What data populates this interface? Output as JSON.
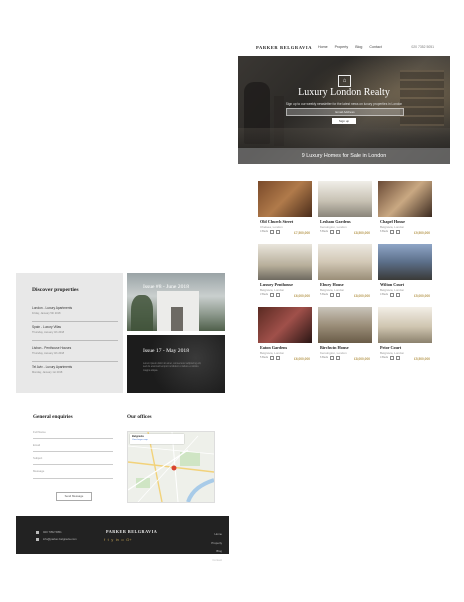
{
  "site": {
    "logo": "PARKER BELGRAVIA",
    "nav": [
      "Home",
      "Property",
      "Blog",
      "Contact"
    ],
    "phone": "020 7352 5051"
  },
  "hero": {
    "title": "Luxury London Realty",
    "subtitle": "Sign up to our weekly newsletter for the latest news on luxury properties in London",
    "input_placeholder": "Email Address",
    "button": "Sign up",
    "banner": "9 Luxury Homes for Sale in London"
  },
  "listings": [
    {
      "name": "Old Church Street",
      "location": "Chelsea, London",
      "beds": "4 Beds",
      "price": "£7,500,000"
    },
    {
      "name": "Lesham Gardens",
      "location": "Kensington, London",
      "beds": "5 Beds",
      "price": "£8,500,000"
    },
    {
      "name": "Chapel House",
      "location": "Belgravia, London",
      "beds": "6 Beds",
      "price": "£9,500,000"
    },
    {
      "name": "Luxury Penthouse",
      "location": "Belgravia, London",
      "beds": "3 Beds",
      "price": "£6,000,000"
    },
    {
      "name": "Ebury House",
      "location": "Belgravia, London",
      "beds": "5 Beds",
      "price": "£8,000,000"
    },
    {
      "name": "Wilton Court",
      "location": "Belgravia, London",
      "beds": "4 Beds",
      "price": "£5,000,000"
    },
    {
      "name": "Eaton Gardens",
      "location": "Belgravia, London",
      "beds": "5 Beds",
      "price": "£6,000,000"
    },
    {
      "name": "Birchwin House",
      "location": "Kensington, London",
      "beds": "6 Beds",
      "price": "£8,000,000"
    },
    {
      "name": "Prior Court",
      "location": "Belgravia, London",
      "beds": "4 Beds",
      "price": "£5,500,000"
    }
  ],
  "discover": {
    "title": "Discover properties",
    "items": [
      {
        "title": "London - Luxury Apartments",
        "date": "Friday, January 5th 2018"
      },
      {
        "title": "Spain - Luxury Villas",
        "date": "Thursday, January 4th 2018"
      },
      {
        "title": "Lisbon - Penthouse Houses",
        "date": "Thursday, January 4th 2018"
      },
      {
        "title": "Tel Aviv - Luxury Apartments",
        "date": "Monday, January 1st 2018"
      }
    ]
  },
  "issues": [
    {
      "title": "Issue #8 - June 2018"
    },
    {
      "title": "Issue 17 - May 2018",
      "text": "Lorem ipsum dolor sit amet, consectetur adipiscing elit, sed do eiusmod tempor incididunt ut labore et dolore magna aliqua."
    }
  ],
  "enquiries": {
    "title": "General enquiries",
    "fields": [
      "Full Name",
      "Email",
      "Subject",
      "Message"
    ],
    "button": "Send Message"
  },
  "offices": {
    "title": "Our offices",
    "map_title": "Belgravia",
    "map_link": "View larger map"
  },
  "footer": {
    "phone": "020 7352 5051",
    "email": "info@parker-belgravia.com",
    "logo": "PARKER BELGRAVIA",
    "social": [
      "f",
      "t",
      "y",
      "in",
      "o",
      "G+"
    ],
    "links": [
      "Home",
      "Property",
      "Blog",
      "Contact"
    ]
  },
  "colors": {
    "accent": "#b89a52",
    "footer_bg": "#222222",
    "panel_bg": "#e8e8e8"
  }
}
